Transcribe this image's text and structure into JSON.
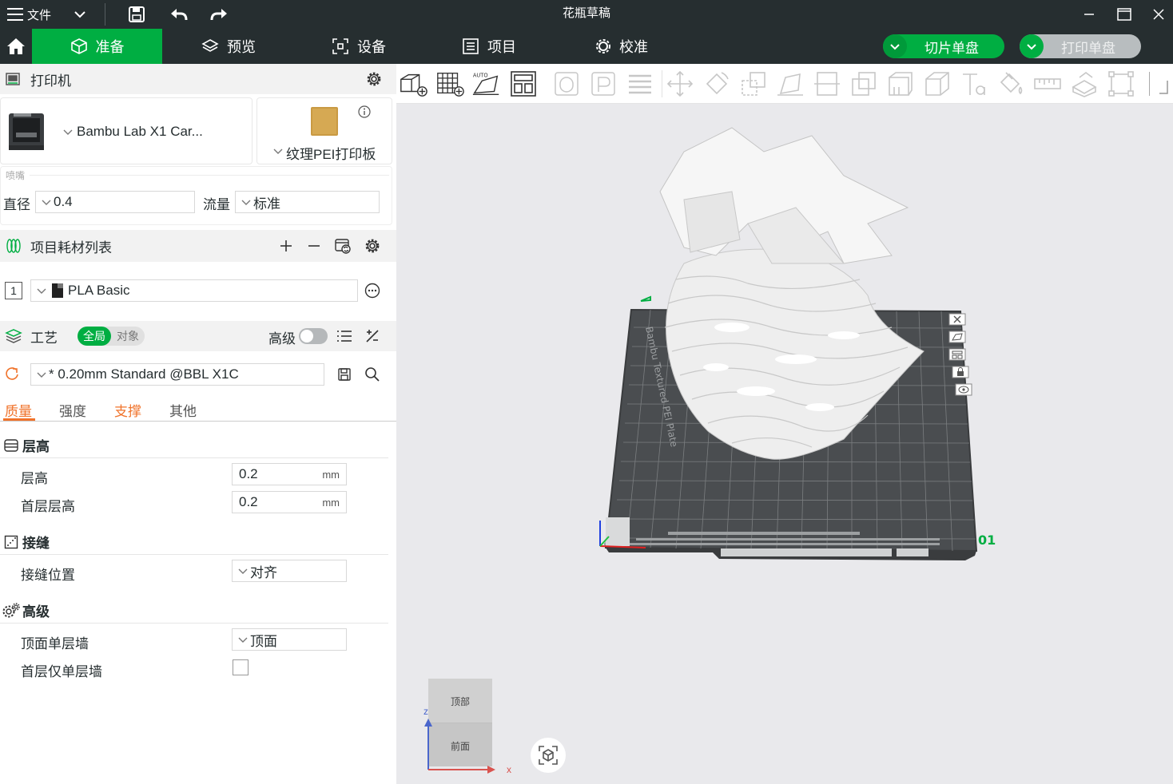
{
  "titlebar": {
    "menu_label": "文件",
    "app_title": "花瓶草稿",
    "icons": [
      "menu-icon",
      "chevron-down-icon",
      "save-icon",
      "undo-icon",
      "redo-icon",
      "minimize-icon",
      "maximize-icon",
      "close-icon"
    ]
  },
  "tabs": [
    {
      "label": "准备",
      "icon": "cube-icon",
      "active": true
    },
    {
      "label": "预览",
      "icon": "layers-icon",
      "active": false
    },
    {
      "label": "设备",
      "icon": "device-icon",
      "active": false
    },
    {
      "label": "项目",
      "icon": "list-icon",
      "active": false
    },
    {
      "label": "校准",
      "icon": "calibrate-icon",
      "active": false
    }
  ],
  "actions": {
    "slice_label": "切片单盘",
    "print_label": "打印单盘"
  },
  "printer_section": {
    "title": "打印机",
    "printer_name": "Bambu Lab X1 Car...",
    "plate_name": "纹理PEI打印板",
    "nozzle_group": "喷嘴",
    "diameter_label": "直径",
    "diameter_value": "0.4",
    "flow_label": "流量",
    "flow_value": "标准"
  },
  "filament_section": {
    "title": "项目耗材列表",
    "items": [
      {
        "index": "1",
        "name": "PLA Basic"
      }
    ]
  },
  "process_section": {
    "title": "工艺",
    "toggle_global": "全局",
    "toggle_object": "对象",
    "advanced_label": "高级",
    "profile_name": "* 0.20mm Standard @BBL X1C",
    "subtabs": [
      {
        "label": "质量",
        "active": true
      },
      {
        "label": "强度",
        "active": false
      },
      {
        "label": "支撑",
        "active": false
      },
      {
        "label": "其他",
        "active": false
      }
    ]
  },
  "settings": {
    "layer_height_group": "层高",
    "layer_height_label": "层高",
    "layer_height_value": "0.2",
    "first_layer_label": "首层层高",
    "first_layer_value": "0.2",
    "unit": "mm",
    "seam_group": "接缝",
    "seam_label": "接缝位置",
    "seam_value": "对齐",
    "advanced_group": "高级",
    "top_wall_label": "顶面单层墙",
    "top_wall_value": "顶面",
    "first_layer_wall_label": "首层仅单层墙",
    "first_layer_wall_checked": false
  },
  "viewport": {
    "plate_label": "Bambu Textured PEI Plate",
    "plate_number": "01",
    "view_cube_top": "顶部",
    "view_cube_front": "前面",
    "axis_z": "z",
    "axis_x": "x"
  },
  "colors": {
    "accent": "#00ae42",
    "titlebar": "#262e30",
    "orange": "#f0732b"
  }
}
